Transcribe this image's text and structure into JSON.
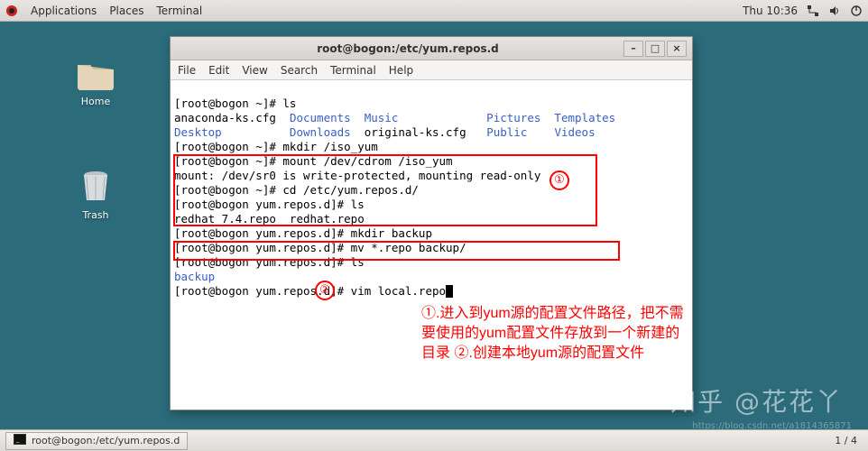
{
  "topbar": {
    "applications": "Applications",
    "places": "Places",
    "terminal": "Terminal",
    "clock": "Thu 10:36"
  },
  "desktop": {
    "home": "Home",
    "trash": "Trash"
  },
  "window": {
    "title": "root@bogon:/etc/yum.repos.d",
    "menu": {
      "file": "File",
      "edit": "Edit",
      "view": "View",
      "search": "Search",
      "terminal": "Terminal",
      "help": "Help"
    },
    "min": "–",
    "max": "□",
    "close": "×"
  },
  "term": {
    "l1": "[root@bogon ~]# ls",
    "l2a": "anaconda-ks.cfg  ",
    "l2b": "Documents  Music             Pictures  Templates",
    "l3a": "Desktop          Downloads",
    "l3b": "  original-ks.cfg   ",
    "l3c": "Public    Videos",
    "l4": "[root@bogon ~]# mkdir /iso_yum",
    "l5": "[root@bogon ~]# mount /dev/cdrom /iso_yum",
    "l6": "mount: /dev/sr0 is write-protected, mounting read-only",
    "l7": "[root@bogon ~]# cd /etc/yum.repos.d/",
    "l8": "[root@bogon yum.repos.d]# ls",
    "l9": "redhat_7.4.repo  redhat.repo",
    "l10": "[root@bogon yum.repos.d]# mkdir backup",
    "l11": "[root@bogon yum.repos.d]# mv *.repo backup/",
    "l12": "[root@bogon yum.repos.d]# ls",
    "l13": "backup",
    "l14": "[root@bogon yum.repos.d]# vim local.repo"
  },
  "annotation": {
    "c1": "①",
    "c2": "②",
    "text": "①.进入到yum源的配置文件路径，把不需要使用的yum配置文件存放到一个新建的目录\n②.创建本地yum源的配置文件"
  },
  "watermark": {
    "big": "知乎 @花花丫",
    "small": "https://blog.csdn.net/a1814365871"
  },
  "taskbar": {
    "title": "root@bogon:/etc/yum.repos.d",
    "pager": "1 / 4"
  }
}
